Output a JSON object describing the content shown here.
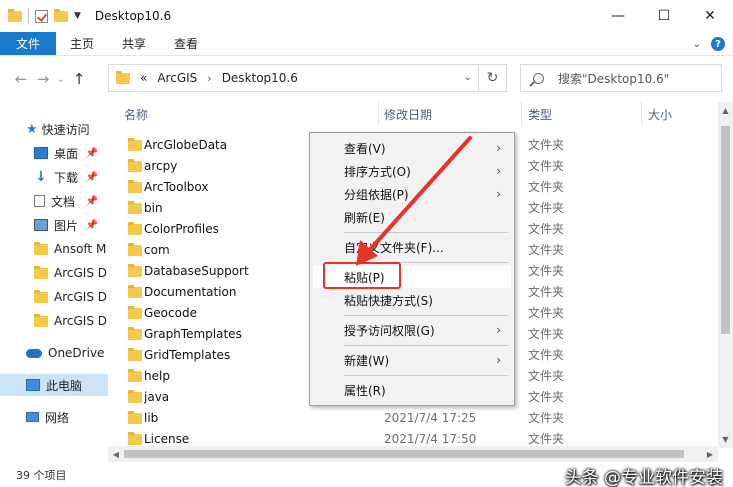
{
  "window": {
    "title": "Desktop10.6",
    "minimize": "—",
    "maximize": "☐",
    "close": "✕"
  },
  "ribbon": {
    "tabs": [
      "文件",
      "主页",
      "共享",
      "查看"
    ]
  },
  "address": {
    "overflow": "«",
    "segments": [
      "ArcGIS",
      "Desktop10.6"
    ],
    "search_placeholder": "搜索\"Desktop10.6\""
  },
  "nav_pane": {
    "quick_access": "快速访问",
    "items": [
      {
        "label": "桌面",
        "icon": "desktop-icon",
        "pinned": true
      },
      {
        "label": "下载",
        "icon": "download-icon",
        "pinned": true
      },
      {
        "label": "文档",
        "icon": "document-icon",
        "pinned": true
      },
      {
        "label": "图片",
        "icon": "picture-icon",
        "pinned": true
      },
      {
        "label": "Ansoft M",
        "icon": "folder-icon",
        "pinned": false
      },
      {
        "label": "ArcGIS D",
        "icon": "folder-icon",
        "pinned": false
      },
      {
        "label": "ArcGIS D",
        "icon": "folder-icon",
        "pinned": false
      },
      {
        "label": "ArcGIS D",
        "icon": "folder-icon",
        "pinned": false
      }
    ],
    "onedrive": "OneDrive",
    "this_pc": "此电脑",
    "network": "网络"
  },
  "columns": {
    "name": "名称",
    "date": "修改日期",
    "type": "类型",
    "size": "大小"
  },
  "files": [
    {
      "name": "ArcGlobeData",
      "date": "",
      "type": "文件夹"
    },
    {
      "name": "arcpy",
      "date": "",
      "type": "文件夹"
    },
    {
      "name": "ArcToolbox",
      "date": "",
      "type": "文件夹"
    },
    {
      "name": "bin",
      "date": "",
      "type": "文件夹"
    },
    {
      "name": "ColorProfiles",
      "date": "",
      "type": "文件夹"
    },
    {
      "name": "com",
      "date": "",
      "type": "文件夹"
    },
    {
      "name": "DatabaseSupport",
      "date": "",
      "type": "文件夹"
    },
    {
      "name": "Documentation",
      "date": "",
      "type": "文件夹"
    },
    {
      "name": "Geocode",
      "date": "",
      "type": "文件夹"
    },
    {
      "name": "GraphTemplates",
      "date": "",
      "type": "文件夹"
    },
    {
      "name": "GridTemplates",
      "date": "",
      "type": "文件夹"
    },
    {
      "name": "help",
      "date": "",
      "type": "文件夹"
    },
    {
      "name": "java",
      "date": "",
      "type": "文件夹"
    },
    {
      "name": "lib",
      "date": "2021/7/4 17:25",
      "type": "文件夹"
    },
    {
      "name": "License",
      "date": "2021/7/4 17:50",
      "type": "文件夹"
    }
  ],
  "context_menu": {
    "view": "查看(V)",
    "sort": "排序方式(O)",
    "group": "分组依据(P)",
    "refresh": "刷新(E)",
    "customize": "自定义文件夹(F)...",
    "paste": "粘贴(P)",
    "paste_shortcut": "粘贴快捷方式(S)",
    "grant_access": "授予访问权限(G)",
    "new": "新建(W)",
    "properties": "属性(R)"
  },
  "status": {
    "count": "39 个项目"
  },
  "watermark": "头条 @专业软件安装",
  "colors": {
    "accent": "#1979ca",
    "highlight_box": "#e8322a",
    "selection": "#cce4f7"
  }
}
